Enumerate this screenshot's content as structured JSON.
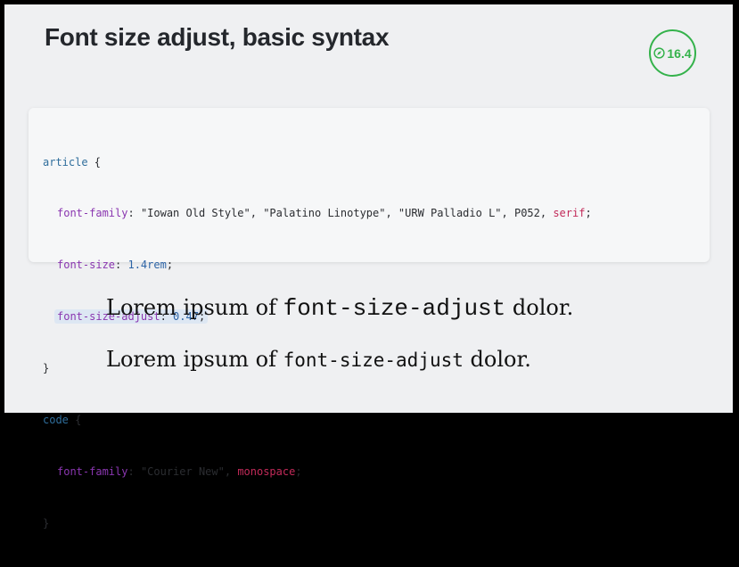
{
  "slide": {
    "title": "Font size adjust, basic syntax",
    "badge": {
      "icon": "safari-compass-icon",
      "version": "16.4",
      "color": "#34b24b"
    }
  },
  "code": {
    "lines": [
      {
        "selector": "article",
        "open": " {"
      },
      {
        "property": "font-family",
        "sep": ": ",
        "value": "\"Iowan Old Style\", \"Palatino Linotype\", \"URW Palladio L\", P052, ",
        "keyword": "serif",
        "end": ";"
      },
      {
        "property": "font-size",
        "sep": ": ",
        "number": "1.4rem",
        "end": ";"
      },
      {
        "property": "font-size-adjust",
        "sep": ": ",
        "number": "0.47",
        "end": ";",
        "highlighted": true
      },
      {
        "close": "}"
      },
      {
        "selector": "code",
        "open": " {"
      },
      {
        "property": "font-family",
        "sep": ": ",
        "value": "\"Courier New\", ",
        "keyword": "monospace",
        "end": ";"
      },
      {
        "close": "}"
      }
    ]
  },
  "demos": [
    {
      "before": "Lorem ipsum of ",
      "code": "font-size-adjust",
      "after": " dolor."
    },
    {
      "before": "Lorem ipsum of ",
      "code": "font-size-adjust",
      "after": " dolor."
    }
  ]
}
